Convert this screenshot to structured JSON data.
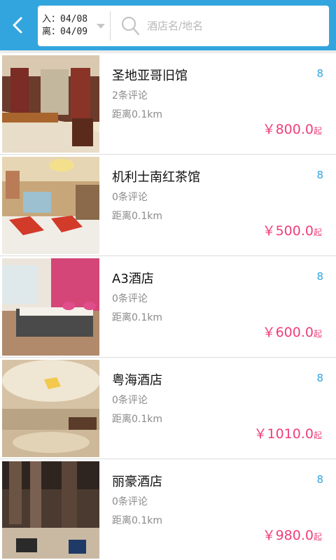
{
  "header": {
    "checkin_label": "入：04/08",
    "checkout_label": "离：04/09",
    "search_placeholder": "酒店名/地名",
    "accent_color": "#33a5de",
    "back_icon": "chevron-left-icon",
    "search_icon": "magnifier-icon"
  },
  "hotels": [
    {
      "name": "圣地亚哥旧馆",
      "reviews": "2条评论",
      "distance": "距离0.1km",
      "rank": "8",
      "price": "￥800.0",
      "price_suffix": "起"
    },
    {
      "name": "机利士南红茶馆",
      "reviews": "0条评论",
      "distance": "距离0.1km",
      "rank": "8",
      "price": "￥500.0",
      "price_suffix": "起"
    },
    {
      "name": "A3酒店",
      "reviews": "0条评论",
      "distance": "距离0.1km",
      "rank": "8",
      "price": "￥600.0",
      "price_suffix": "起"
    },
    {
      "name": "粤海酒店",
      "reviews": "0条评论",
      "distance": "距离0.1km",
      "rank": "8",
      "price": "￥1010.0",
      "price_suffix": "起"
    },
    {
      "name": "丽豪酒店",
      "reviews": "0条评论",
      "distance": "距离0.1km",
      "rank": "8",
      "price": "￥980.0",
      "price_suffix": "起"
    }
  ],
  "colors": {
    "price": "#ef3f7a",
    "rank": "#33a5de"
  }
}
